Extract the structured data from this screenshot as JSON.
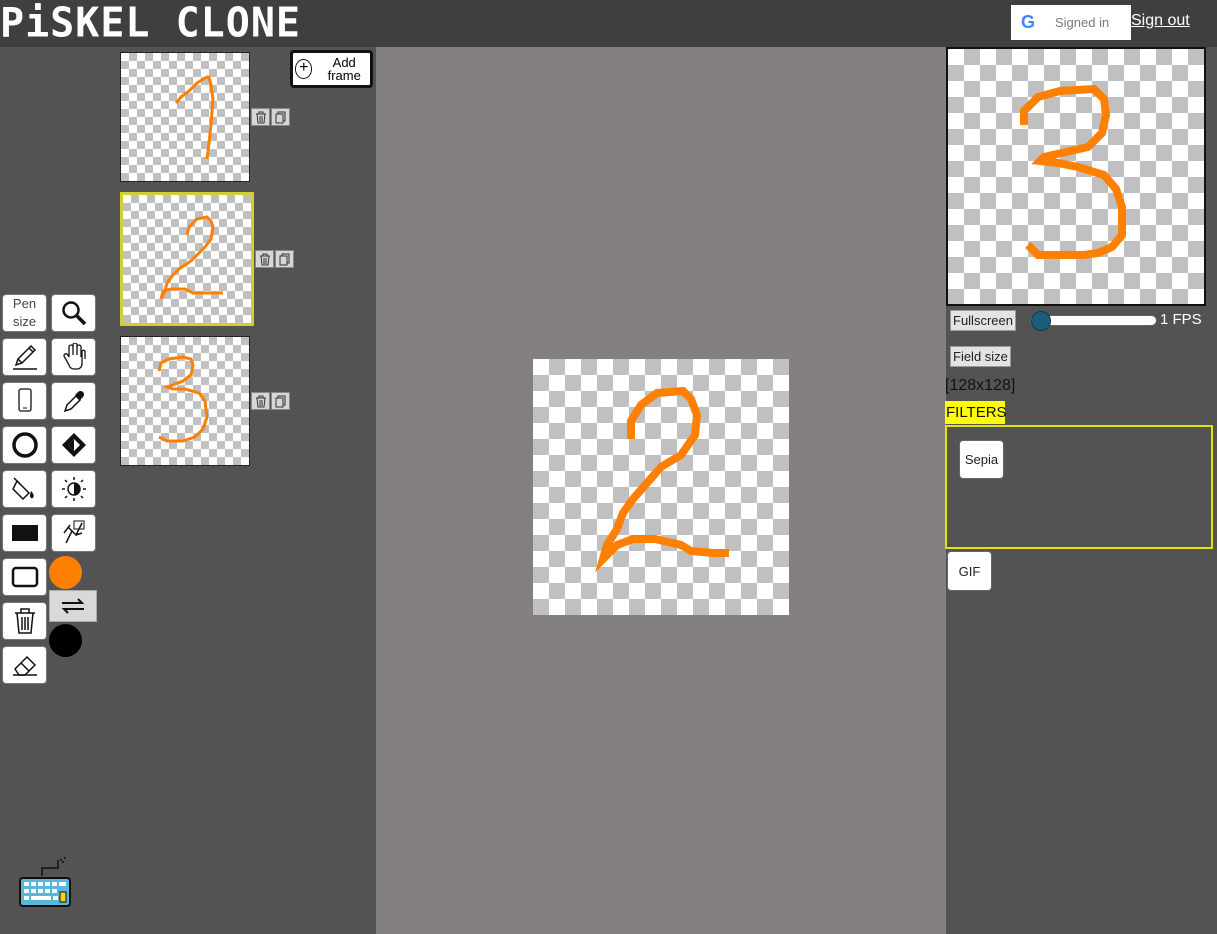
{
  "app": {
    "logo_text": "PiSKEL CLONE"
  },
  "auth": {
    "google_glyph": "G",
    "signed_in_label": "Signed in",
    "sign_out_label": "Sign out"
  },
  "frames": {
    "add_frame_label": "Add frame",
    "items": [
      {
        "digit": "1",
        "active": false
      },
      {
        "digit": "2",
        "active": true
      },
      {
        "digit": "3",
        "active": false
      }
    ]
  },
  "tools": {
    "pen_size_label": "Pen size",
    "primary_color": "#ff8000",
    "secondary_color": "#000000",
    "icons": [
      "magnifier-icon",
      "pencil-icon",
      "hand-icon",
      "mirror-pen-icon",
      "eyedropper-icon",
      "circle-icon",
      "lighten-icon",
      "paint-bucket-icon",
      "dither-icon",
      "rectangle-filled-icon",
      "move-icon",
      "rectangle-outline-icon",
      "trash-icon",
      "eraser-icon",
      "swap-colors-icon",
      "keyboard-icon"
    ]
  },
  "preview": {
    "fullscreen_label": "Fullscreen",
    "fps_label": "1 FPS",
    "fps_value": 1,
    "field_size_label": "Field size",
    "size_text": "[128x128]"
  },
  "filters": {
    "label": "FILTERS",
    "sepia_label": "Sepia",
    "gif_label": "GIF"
  },
  "colors": {
    "stroke": "#ff8000",
    "active_frame": "#d0d030",
    "filters_yellow": "#ffff00"
  }
}
